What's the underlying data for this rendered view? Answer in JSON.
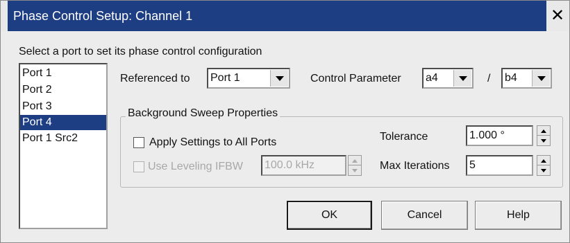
{
  "window": {
    "title": "Phase Control Setup: Channel 1",
    "close_glyph": "✕"
  },
  "instruction": "Select a port to set its phase control configuration",
  "ports": [
    "Port 1",
    "Port 2",
    "Port 3",
    "Port 4",
    "Port 1 Src2"
  ],
  "selected_port": "Port 4",
  "referenced_to": {
    "label": "Referenced to",
    "value": "Port 1"
  },
  "control_parameter": {
    "label": "Control Parameter",
    "numerator": "a4",
    "separator": "/",
    "denominator": "b4"
  },
  "background_sweep": {
    "legend": "Background Sweep Properties",
    "apply_all": {
      "label": "Apply Settings to All Ports",
      "checked": false
    },
    "use_leveling": {
      "label": "Use Leveling IFBW",
      "value": "100.0 kHz",
      "enabled": false,
      "checked": false
    },
    "tolerance": {
      "label": "Tolerance",
      "value": "1.000 °"
    },
    "max_iterations": {
      "label": "Max Iterations",
      "value": "5"
    }
  },
  "buttons": {
    "ok": "OK",
    "cancel": "Cancel",
    "help": "Help"
  },
  "colors": {
    "title_bar": "#1e3e83",
    "selection": "#1e3e83",
    "dialog_bg": "#ececec"
  },
  "icons": {
    "close": "close-icon",
    "dropdown": "chevron-down-icon",
    "spinner": "spinner-arrows-icon"
  }
}
